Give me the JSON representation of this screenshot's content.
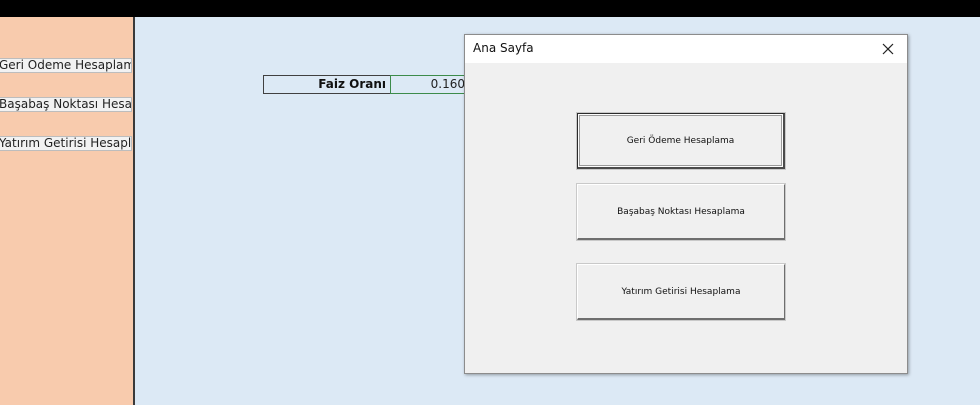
{
  "sidebar": {
    "items": [
      {
        "label": "Geri Ödeme Hesaplama"
      },
      {
        "label": "Başabaş Noktası Hesaplama"
      },
      {
        "label": "Yatırım Getirisi Hesaplama"
      }
    ]
  },
  "sheet": {
    "interest_label": "Faiz Oranı",
    "interest_value": "0.160"
  },
  "dialog": {
    "title": "Ana Sayfa",
    "close_glyph": "✕",
    "buttons": [
      {
        "label": "Geri Ödeme Hesaplama"
      },
      {
        "label": "Başabaş Noktası Hesaplama"
      },
      {
        "label": "Yatırım Getirisi Hesaplama"
      }
    ]
  }
}
